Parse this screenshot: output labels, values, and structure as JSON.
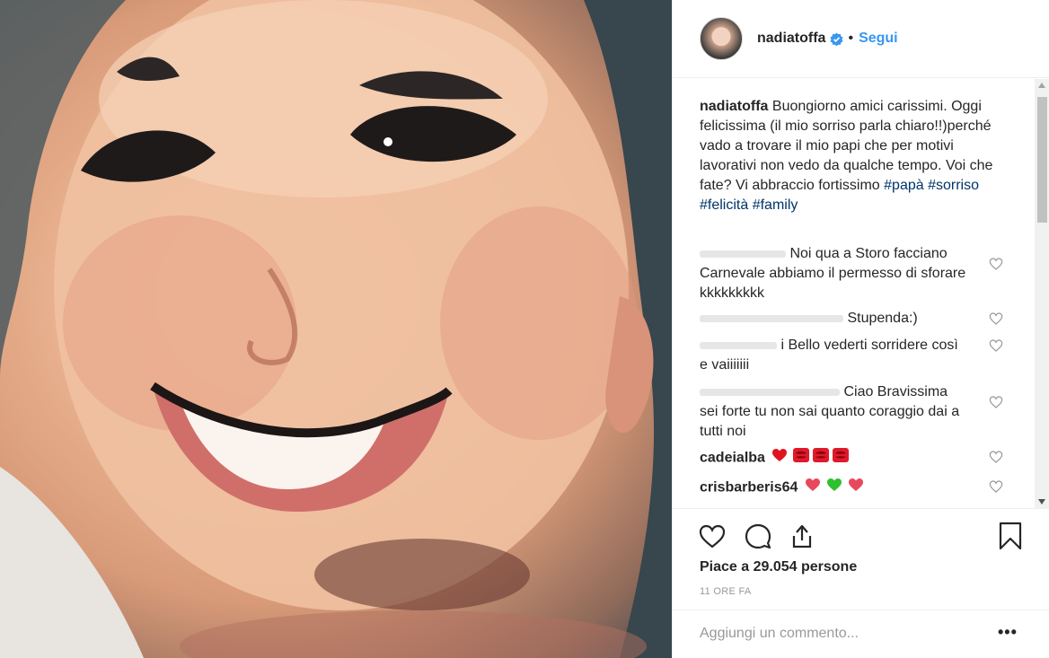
{
  "post": {
    "username": "nadiatoffa",
    "separator": "•",
    "follow_label": "Segui",
    "caption": {
      "username": "nadiatoffa",
      "text": " Buongiorno amici carissimi. Oggi felicissima (il mio sorriso parla chiaro!!)perché vado a trovare il mio papi che per motivi lavorativi non vedo da qualche tempo. Voi che fate? Vi abbraccio fortissimo ",
      "hashtags": [
        "#papà",
        "#sorriso",
        "#felicità",
        "#family"
      ]
    },
    "comments": [
      {
        "user": "",
        "text": "Noi qua a Storo facciano Carnevale abbiamo il permesso di sforare kkkkkkkkk"
      },
      {
        "user": "",
        "text": "Stupenda:)"
      },
      {
        "user": "",
        "text": "i Bello vederti sorridere così e vaiiiiiii"
      },
      {
        "user": "",
        "text": "Ciao Bravissima sei forte tu non sai quanto coraggio dai a tutti noi"
      },
      {
        "user": "cadeialba",
        "text": ""
      },
      {
        "user": "crisbarberis64",
        "text": ""
      }
    ],
    "likes_text": "Piace a 29.054 persone",
    "time_text": "11 ORE FA",
    "comment_placeholder": "Aggiungi un commento...",
    "more_label": "•••"
  },
  "icons": {
    "verified": "verified-badge-icon",
    "like": "heart-icon",
    "comment": "comment-bubble-icon",
    "share": "share-icon",
    "save": "bookmark-icon",
    "comment_like": "small-heart-icon"
  },
  "colors": {
    "link_blue": "#3897f0",
    "hashtag": "#003569",
    "muted": "#999999",
    "text": "#262626",
    "border": "#efefef"
  }
}
